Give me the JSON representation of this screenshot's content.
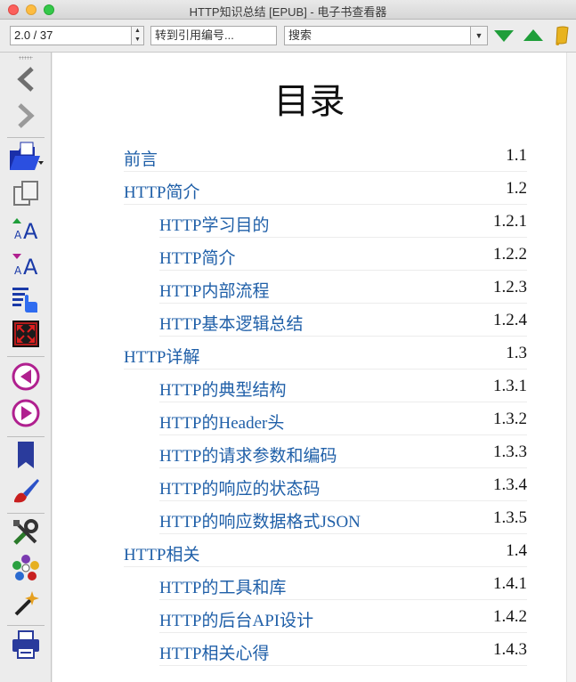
{
  "window": {
    "title": "HTTP知识总结 [EPUB] - 电子书查看器"
  },
  "toolbar": {
    "page_value": "2.0 / 37",
    "goto_placeholder": "转到引用编号...",
    "search_placeholder": "搜索"
  },
  "sidebar": {
    "buttons": [
      "back-icon",
      "forward-icon",
      "open-book-icon",
      "copy-icon",
      "font-larger-icon",
      "font-smaller-icon",
      "toc-icon",
      "fullscreen-icon",
      "previous-section-icon",
      "next-section-icon",
      "bookmark-icon",
      "theme-brush-icon",
      "preferences-icon",
      "reference-mode-icon",
      "lookup-icon",
      "print-icon"
    ]
  },
  "content": {
    "heading": "目录",
    "toc": [
      {
        "label": "前言",
        "num": "1.1",
        "level": 1
      },
      {
        "label": "HTTP简介",
        "num": "1.2",
        "level": 1
      },
      {
        "label": "HTTP学习目的",
        "num": "1.2.1",
        "level": 2
      },
      {
        "label": "HTTP简介",
        "num": "1.2.2",
        "level": 2
      },
      {
        "label": "HTTP内部流程",
        "num": "1.2.3",
        "level": 2
      },
      {
        "label": "HTTP基本逻辑总结",
        "num": "1.2.4",
        "level": 2
      },
      {
        "label": "HTTP详解",
        "num": "1.3",
        "level": 1
      },
      {
        "label": "HTTP的典型结构",
        "num": "1.3.1",
        "level": 2
      },
      {
        "label": "HTTP的Header头",
        "num": "1.3.2",
        "level": 2
      },
      {
        "label": "HTTP的请求参数和编码",
        "num": "1.3.3",
        "level": 2
      },
      {
        "label": "HTTP的响应的状态码",
        "num": "1.3.4",
        "level": 2
      },
      {
        "label": "HTTP的响应数据格式JSON",
        "num": "1.3.5",
        "level": 2
      },
      {
        "label": "HTTP相关",
        "num": "1.4",
        "level": 1
      },
      {
        "label": "HTTP的工具和库",
        "num": "1.4.1",
        "level": 2
      },
      {
        "label": "HTTP的后台API设计",
        "num": "1.4.2",
        "level": 2
      },
      {
        "label": "HTTP相关心得",
        "num": "1.4.3",
        "level": 2
      }
    ]
  },
  "colors": {
    "link": "#1f5fa8",
    "accent_green": "#1f9e3a"
  }
}
